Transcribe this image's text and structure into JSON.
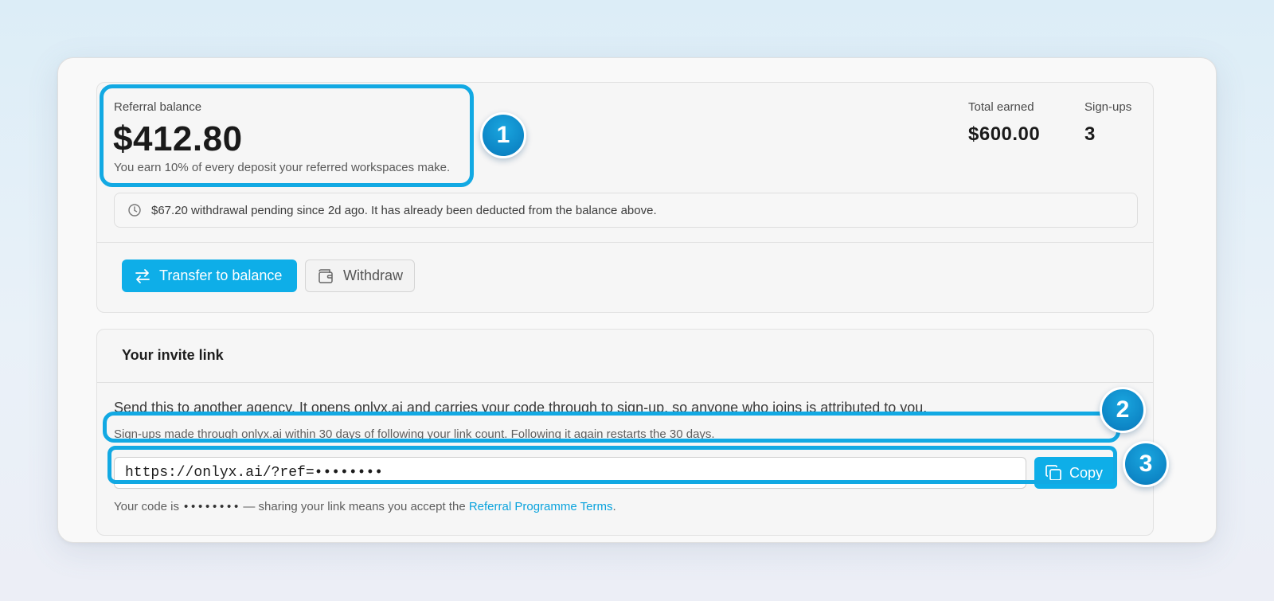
{
  "balance": {
    "label": "Referral balance",
    "amount": "$412.80",
    "note": "You earn 10% of every deposit your referred workspaces make."
  },
  "stats": {
    "total_earned_label": "Total earned",
    "total_earned_value": "$600.00",
    "signups_label": "Sign-ups",
    "signups_value": "3"
  },
  "pending": {
    "icon": "clock-icon",
    "text": "$67.20 withdrawal pending since 2d ago. It has already been deducted from the balance above."
  },
  "actions": {
    "transfer_label": "Transfer to balance",
    "transfer_icon": "swap-arrows-icon",
    "withdraw_label": "Withdraw",
    "withdraw_icon": "wallet-icon"
  },
  "invite": {
    "title": "Your invite link",
    "description": "Send this to another agency. It opens onlyx.ai and carries your code through to sign-up, so anyone who joins is attributed to you.",
    "attribution_note": "Sign-ups made through onlyx.ai within 30 days of following your link count. Following it again restarts the 30 days.",
    "link_value": "https://onlyx.ai/?ref=••••••••",
    "copy_label": "Copy",
    "copy_icon": "copy-icon",
    "code_prefix": "Your code is ",
    "code_masked": "••••••••",
    "code_middle": " — sharing your link means you accept the ",
    "terms_link": "Referral Programme Terms",
    "code_suffix": "."
  },
  "annotations": {
    "badge_1": "1",
    "badge_2": "2",
    "badge_3": "3"
  },
  "colors": {
    "accent": "#0eaee8",
    "highlight": "#12a9e3",
    "badge": "#0d86c6",
    "link": "#0aa3dd"
  }
}
